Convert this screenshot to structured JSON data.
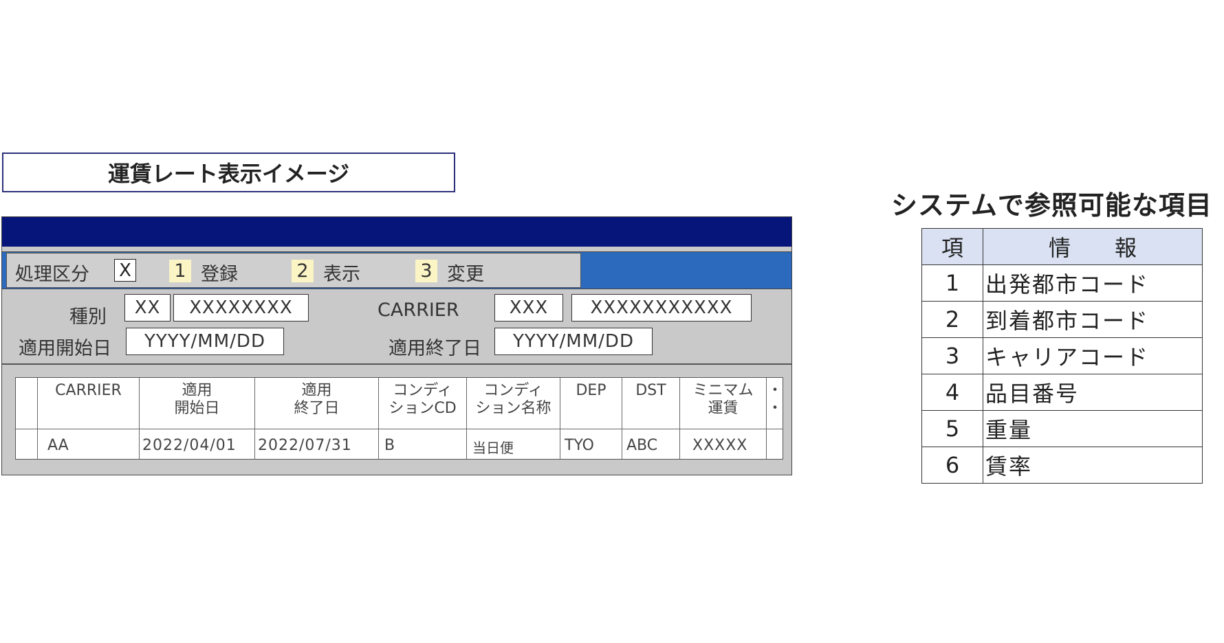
{
  "title": "運賃レート表示イメージ",
  "mode_bar": {
    "label": "処理区分",
    "checkbox_value": "X",
    "options": [
      {
        "num": "1",
        "label": "登録"
      },
      {
        "num": "2",
        "label": "表示"
      },
      {
        "num": "3",
        "label": "変更"
      }
    ]
  },
  "form": {
    "kind_label": "種別",
    "kind_code": "XX",
    "kind_name": "XXXXXXXX",
    "carrier_label": "CARRIER",
    "carrier_code": "XXX",
    "carrier_name": "XXXXXXXXXXX",
    "start_label": "適用開始日",
    "start_value": "YYYY/MM/DD",
    "end_label": "適用終了日",
    "end_value": "YYYY/MM/DD"
  },
  "grid": {
    "headers": [
      "CARRIER",
      "適用\n開始日",
      "適用\n終了日",
      "コンディ\nションCD",
      "コンディ\nション名称",
      "DEP",
      "DST",
      "ミニマム\n運賃",
      "・\n・"
    ],
    "rows": [
      [
        "AA",
        "2022/04/01",
        "2022/07/31",
        "B",
        "当日便",
        "TYO",
        "ABC",
        "XXXXX",
        ""
      ]
    ]
  },
  "reference": {
    "heading": "システムで参照可能な項目",
    "col_no": "項",
    "col_info": "情　　報",
    "items": [
      {
        "no": "1",
        "info": "出発都市コード"
      },
      {
        "no": "2",
        "info": "到着都市コード"
      },
      {
        "no": "3",
        "info": "キャリアコード"
      },
      {
        "no": "4",
        "info": "品目番号"
      },
      {
        "no": "5",
        "info": "重量"
      },
      {
        "no": "6",
        "info": "賃率"
      }
    ]
  },
  "colors": {
    "titlebar": "#06157a",
    "mode_strip": "#2b6abd",
    "window_bg": "#c9c9c9",
    "number_highlight": "#fbf4c4",
    "ref_header_bg": "#d9e1f2"
  }
}
